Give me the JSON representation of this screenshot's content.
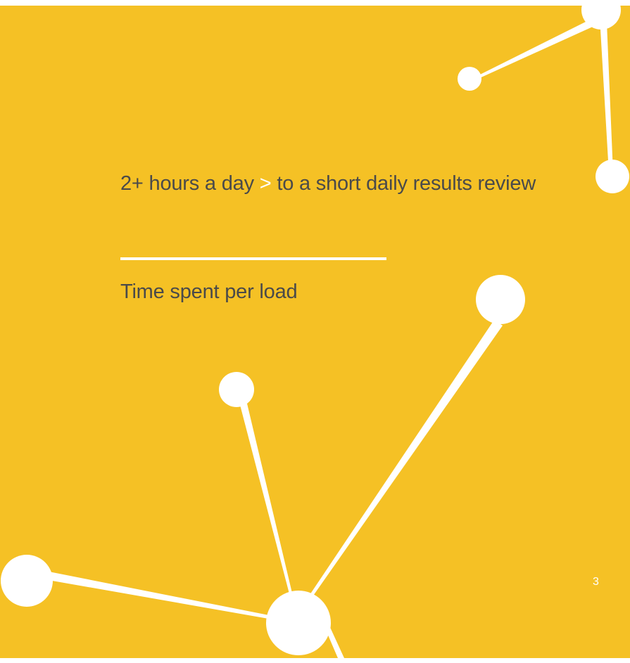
{
  "slide": {
    "background_color": "#f5c125",
    "accent_color": "#ffffff",
    "text_color": "#4a4a4a",
    "headline": {
      "before": "2+ hours a day",
      "separator": ">",
      "after": "to a short daily results review"
    },
    "subtitle": "Time spent per load",
    "page_number": "3"
  }
}
